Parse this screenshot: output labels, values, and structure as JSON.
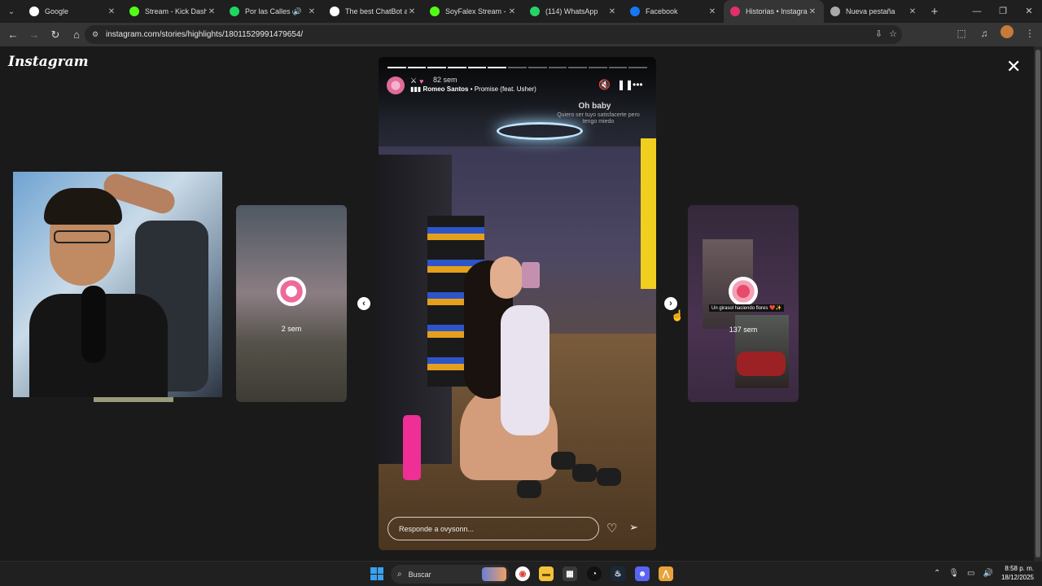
{
  "browser": {
    "tabs": [
      {
        "label": "Google",
        "icon": "google-icon",
        "color": "#ffffff"
      },
      {
        "label": "Stream - Kick Dashbo",
        "icon": "kick-icon",
        "color": "#53fc18"
      },
      {
        "label": "Por las Calles del",
        "icon": "spotify-icon",
        "color": "#1ed760",
        "audio": "🔊"
      },
      {
        "label": "The best ChatBot and",
        "icon": "chatbot-icon",
        "color": "#ffffff"
      },
      {
        "label": "SoyFalex Stream - W",
        "icon": "kick-icon",
        "color": "#53fc18"
      },
      {
        "label": "(114) WhatsApp",
        "icon": "whatsapp-icon",
        "color": "#25d366"
      },
      {
        "label": "Facebook",
        "icon": "facebook-icon",
        "color": "#1877f2"
      },
      {
        "label": "Historias • Instagram",
        "icon": "instagram-icon",
        "color": "#e1306c",
        "active": true
      },
      {
        "label": "Nueva pestaña",
        "icon": "chrome-icon",
        "color": "#aaaaaa"
      }
    ],
    "url": "instagram.com/stories/highlights/18011529991479654/"
  },
  "instagram": {
    "logo": "Instagram",
    "close_label": "✕",
    "left_story_time": "2 sem",
    "right_story_time": "137 sem",
    "right_story_caption": "Un girasol haciendo flores ❤️✨",
    "main_story": {
      "time": "82 sem",
      "music_artist": "Romeo Santos",
      "music_separator": " • ",
      "music_song": "Promise (feat. Usher)",
      "lyric_line1": "Oh baby",
      "lyric_line2": "Quiero ser tuyo satisfacerte pero tengo miedo",
      "reply_placeholder": "Responde a ovysonn...",
      "progress_total": 13,
      "progress_done": 6
    }
  },
  "taskbar": {
    "search_label": "Buscar",
    "time": "8:58 p. m.",
    "date": "18/12/2025"
  }
}
